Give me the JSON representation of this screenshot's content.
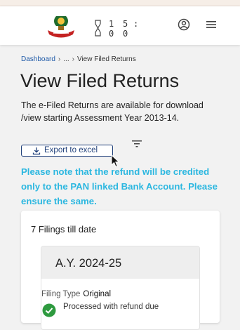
{
  "header": {
    "timer": {
      "digits": [
        "1",
        "5",
        "0",
        "0"
      ],
      "separator": ":"
    },
    "icons": {
      "logo": "emblem-logo",
      "account": "account-circle-icon",
      "menu": "hamburger-menu-icon",
      "hourglass": "hourglass-icon"
    }
  },
  "breadcrumb": {
    "home": "Dashboard",
    "sep": "›",
    "ellipsis": "...",
    "current": "View Filed Returns"
  },
  "page": {
    "title": "View Filed Returns",
    "description": "The e-Filed Returns are available for download /view starting Assessment Year 2013-14.",
    "export_label": "Export to excel",
    "notice": "Please note that the refund will be credited only to the PAN linked Bank Account. Please ensure the same."
  },
  "filings": {
    "count_text": "7 Filings till date",
    "items": [
      {
        "ay": "A.Y. 2024-25",
        "filing_type_label": "Filing Type",
        "filing_type": "Original",
        "status": "Processed with refund due"
      }
    ]
  },
  "colors": {
    "notice": "#2bb7e0",
    "link": "#1f5aa8",
    "success": "#2e9a3f",
    "button_border": "#1f3f7a"
  }
}
